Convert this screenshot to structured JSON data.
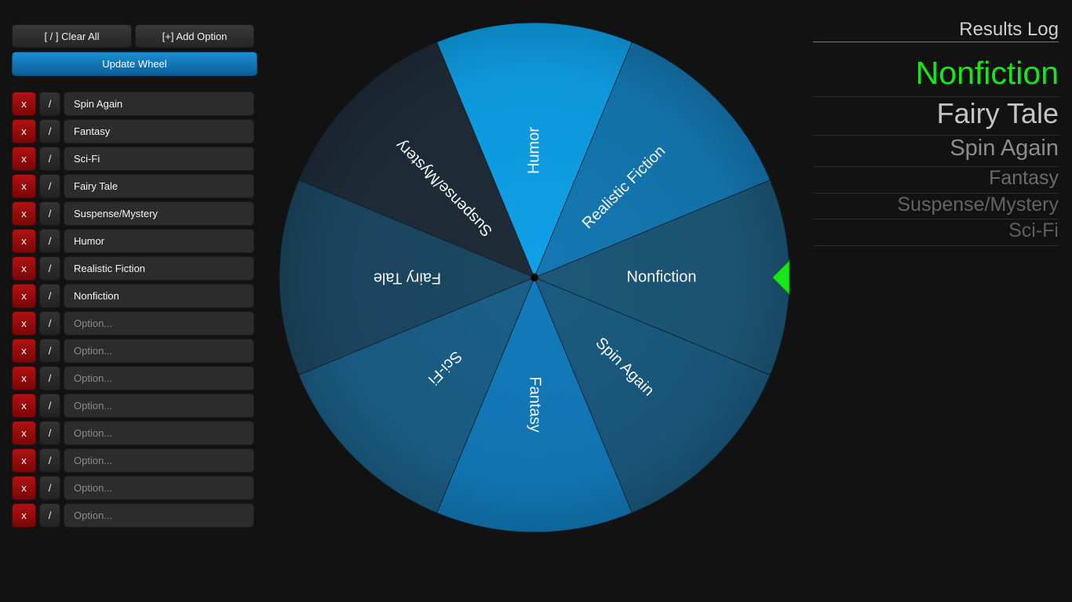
{
  "controls": {
    "clear_all_label": "[ / ] Clear All",
    "add_option_label": "[+] Add Option",
    "update_wheel_label": "Update Wheel"
  },
  "options": [
    {
      "delete_label": "x",
      "toggle_label": "/",
      "value": "Spin Again",
      "placeholder": "Option..."
    },
    {
      "delete_label": "x",
      "toggle_label": "/",
      "value": "Fantasy",
      "placeholder": "Option..."
    },
    {
      "delete_label": "x",
      "toggle_label": "/",
      "value": "Sci-Fi",
      "placeholder": "Option..."
    },
    {
      "delete_label": "x",
      "toggle_label": "/",
      "value": "Fairy Tale",
      "placeholder": "Option..."
    },
    {
      "delete_label": "x",
      "toggle_label": "/",
      "value": "Suspense/Mystery",
      "placeholder": "Option..."
    },
    {
      "delete_label": "x",
      "toggle_label": "/",
      "value": "Humor",
      "placeholder": "Option..."
    },
    {
      "delete_label": "x",
      "toggle_label": "/",
      "value": "Realistic Fiction",
      "placeholder": "Option..."
    },
    {
      "delete_label": "x",
      "toggle_label": "/",
      "value": "Nonfiction",
      "placeholder": "Option..."
    },
    {
      "delete_label": "x",
      "toggle_label": "/",
      "value": "",
      "placeholder": "Option..."
    },
    {
      "delete_label": "x",
      "toggle_label": "/",
      "value": "",
      "placeholder": "Option..."
    },
    {
      "delete_label": "x",
      "toggle_label": "/",
      "value": "",
      "placeholder": "Option..."
    },
    {
      "delete_label": "x",
      "toggle_label": "/",
      "value": "",
      "placeholder": "Option..."
    },
    {
      "delete_label": "x",
      "toggle_label": "/",
      "value": "",
      "placeholder": "Option..."
    },
    {
      "delete_label": "x",
      "toggle_label": "/",
      "value": "",
      "placeholder": "Option..."
    },
    {
      "delete_label": "x",
      "toggle_label": "/",
      "value": "",
      "placeholder": "Option..."
    },
    {
      "delete_label": "x",
      "toggle_label": "/",
      "value": "",
      "placeholder": "Option..."
    }
  ],
  "wheel": {
    "segments": [
      {
        "label": "Nonfiction",
        "color": "#1d5878"
      },
      {
        "label": "Spin Again",
        "color": "#1b5a80"
      },
      {
        "label": "Fantasy",
        "color": "#127bbb"
      },
      {
        "label": "Sci-Fi",
        "color": "#1b5f88"
      },
      {
        "label": "Fairy Tale",
        "color": "#1c4862"
      },
      {
        "label": "Suspense/Mystery",
        "color": "#1f2c38"
      },
      {
        "label": "Humor",
        "color": "#0fa0e8"
      },
      {
        "label": "Realistic Fiction",
        "color": "#1478b3"
      }
    ],
    "pointer_color": "#19e619",
    "hub_color": "#0a0a0a",
    "label_color": "#ffffff"
  },
  "results": {
    "title": "Results Log",
    "entries": [
      {
        "label": "Nonfiction",
        "color": "#19e619"
      },
      {
        "label": "Fairy Tale",
        "color": "#c4c4c4"
      },
      {
        "label": "Spin Again",
        "color": "#8c8c8c"
      },
      {
        "label": "Fantasy",
        "color": "#6c6c6c"
      },
      {
        "label": "Suspense/Mystery",
        "color": "#636363"
      },
      {
        "label": "Sci-Fi",
        "color": "#5e5e5e"
      }
    ]
  }
}
